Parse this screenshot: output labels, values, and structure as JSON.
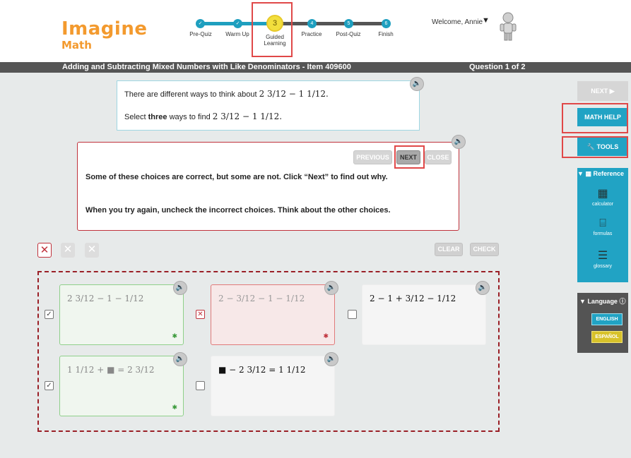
{
  "brand": {
    "name": "Imagine",
    "sub": "Math"
  },
  "progress": {
    "steps": [
      {
        "label": "Pre-Quiz",
        "marker": "✓"
      },
      {
        "label": "Warm Up",
        "marker": "✓"
      },
      {
        "label": "Guided Learning",
        "marker": "3"
      },
      {
        "label": "Practice",
        "marker": "4"
      },
      {
        "label": "Post-Quiz",
        "marker": "5"
      },
      {
        "label": "Finish",
        "marker": "6"
      }
    ],
    "current_step": 3
  },
  "user": {
    "welcome": "Welcome, Annie",
    "caret": "▼"
  },
  "titlebar": {
    "title": "Adding and Subtracting Mixed Numbers with Like Denominators - Item 409600",
    "question": "Question 1 of 2"
  },
  "question": {
    "line1_text": "There are different ways to think about",
    "line1_math": "2 3/12 − 1 1/12.",
    "line2_pre": "Select",
    "line2_bold": "three",
    "line2_post": "ways to find",
    "line2_math": "2 3/12 − 1 1/12."
  },
  "feedback": {
    "buttons": {
      "previous": "PREVIOUS",
      "next": "NEXT",
      "close": "CLOSE"
    },
    "line1": "Some of these choices are correct, but some are not. Click “Next” to find out why.",
    "line2": "When you try again, uncheck the incorrect choices. Think about the other choices."
  },
  "toolbar": {
    "clear": "CLEAR",
    "check": "CHECK"
  },
  "answers": [
    {
      "expr": "2 3/12 − 1 − 1/12",
      "checked": true,
      "state": "correct"
    },
    {
      "expr": "2 − 3/12 − 1 − 1/12",
      "checked": true,
      "state": "wrong"
    },
    {
      "expr": "2 − 1 + 3/12 − 1/12",
      "checked": false,
      "state": "plain"
    },
    {
      "expr": "1 1/12 + ■ = 2 3/12",
      "checked": true,
      "state": "correct"
    },
    {
      "expr": "■ − 2 3/12 = 1 1/12",
      "checked": false,
      "state": "plain"
    }
  ],
  "sidebar": {
    "next": "NEXT ▶",
    "math_help": "MATH HELP",
    "tools": "TOOLS",
    "reference_title": "Reference",
    "reference_items": [
      "calculator",
      "formulas",
      "glossary"
    ],
    "language_title": "Language",
    "languages": [
      "ENGLISH",
      "ESPAÑOL"
    ]
  },
  "colors": {
    "accent": "#21a3c4",
    "brand": "#f39a2e",
    "error": "#c0323c",
    "current_step": "#f2df3d"
  }
}
